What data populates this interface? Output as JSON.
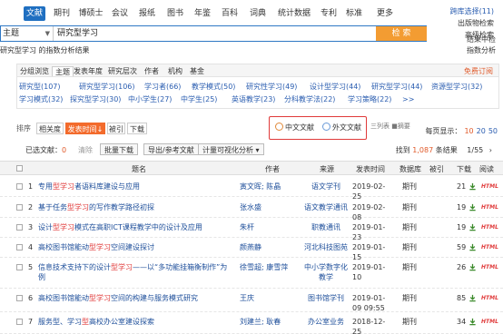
{
  "nav": {
    "tabs": [
      "文献",
      "期刊",
      "博硕士",
      "会议",
      "报纸",
      "图书",
      "年鉴",
      "百科",
      "词典",
      "统计数据",
      "专利",
      "标准",
      "更多>>"
    ],
    "right_links": [
      "跨库选择(11)",
      "出版物检索",
      "高级检索"
    ]
  },
  "search": {
    "scope": "主题",
    "query": "研究型学习",
    "button": "检 索",
    "hint": "研究型学习 的指数分析结果",
    "right_links": [
      "结果中检",
      "指数分析"
    ]
  },
  "grouping": {
    "tabs": [
      "分组浏览",
      "主题",
      "发表年度",
      "研究层次",
      "作者",
      "机构",
      "基金"
    ],
    "freq_label": "免费订阅",
    "items": [
      [
        "研究型(107)",
        "研究型学习(106)",
        "学习者(66)",
        "教学模式(50)",
        "研究性学习(49)",
        "设计型学习(44)",
        "研究型学习(44)",
        "资源型学习(32)"
      ],
      [
        "学习模式(32)",
        "探究型学习(30)",
        "中小学生(27)",
        "中学生(25)",
        "英语教学(23)",
        "分科教学法(22)",
        "学习策略(22)",
        ">>"
      ]
    ]
  },
  "toolbar": {
    "sort_label": "排序",
    "sort_buttons": [
      "相关度",
      "发表时间↓",
      "被引",
      "下载"
    ],
    "lang_cn": "中文文献",
    "lang_en": "外文文献",
    "view_label": "三列表  ■摘要",
    "per_page_label": "每页显示：",
    "per_page": [
      "10",
      "20",
      "50"
    ]
  },
  "selection": {
    "label": "已选文献：",
    "count": "0",
    "clear": "清除",
    "actions": [
      "批量下载",
      "导出/参考文献",
      "计量可视化分析 ▾"
    ],
    "found_prefix": "找到",
    "found_count": "1,087",
    "found_suffix": "条结果",
    "page": "1/55",
    "page_next": "›"
  },
  "table": {
    "headers": [
      "题名",
      "作者",
      "来源",
      "发表时间",
      "数据库",
      "被引",
      "下载",
      "阅读"
    ],
    "rows": [
      {
        "n": "1",
        "pre": "专用",
        "hl": "型学习",
        "post": "者语料库建设与应用",
        "author": "寅文晖; 陈晶",
        "src": "语文学刊",
        "date": "2019-02-25",
        "db": "期刊",
        "cite": "",
        "dl": "21"
      },
      {
        "n": "2",
        "pre": "基于任务",
        "hl": "型学习",
        "post": "的写作教学路径初探",
        "author": "张水盛",
        "src": "语文教学通讯",
        "date": "2019-02-08",
        "db": "期刊",
        "cite": "",
        "dl": "19"
      },
      {
        "n": "3",
        "pre": "设计",
        "hl": "型学习",
        "post": "模式在高职ICT课程教学中的设计及应用",
        "author": "朱杆",
        "src": "职教通讯",
        "date": "2019-01-23",
        "db": "期刊",
        "cite": "",
        "dl": "19"
      },
      {
        "n": "4",
        "pre": "高校图书馆能动",
        "hl": "型学习",
        "post": "空间建设探讨",
        "author": "颜燕静",
        "src": "河北科技图苑",
        "date": "2019-01-15",
        "db": "期刊",
        "cite": "",
        "dl": "59"
      },
      {
        "n": "5",
        "pre": "信息技术支持下的设计",
        "hl": "型学习",
        "post": "——以“多功能挂箱衡制作”为例",
        "author": "徐雪超; 康雪萍",
        "src": "中小学数字化教学",
        "date": "2019-01-10",
        "db": "期刊",
        "cite": "",
        "dl": "26"
      },
      {
        "n": "6",
        "pre": "高校图书馆能动",
        "hl": "型学习",
        "post": "空间的构建与服务模式研究",
        "author": "王庆",
        "src": "图书馆学刊",
        "date": "2019-01-09 09:55",
        "db": "期刊",
        "cite": "",
        "dl": "85"
      },
      {
        "n": "7",
        "pre": "服务型、学习",
        "hl": "型",
        "post": "高校办公室建设探索",
        "author": "刘建兰; 耿春",
        "src": "办公室业务",
        "date": "2018-12-25",
        "db": "期刊",
        "cite": "",
        "dl": "34"
      }
    ],
    "read_label": "HTML"
  },
  "colors": {
    "brand": "#1f6fc1",
    "accent": "#f36b2c",
    "highlight": "#e03a3a",
    "link": "#1d4e9a"
  }
}
